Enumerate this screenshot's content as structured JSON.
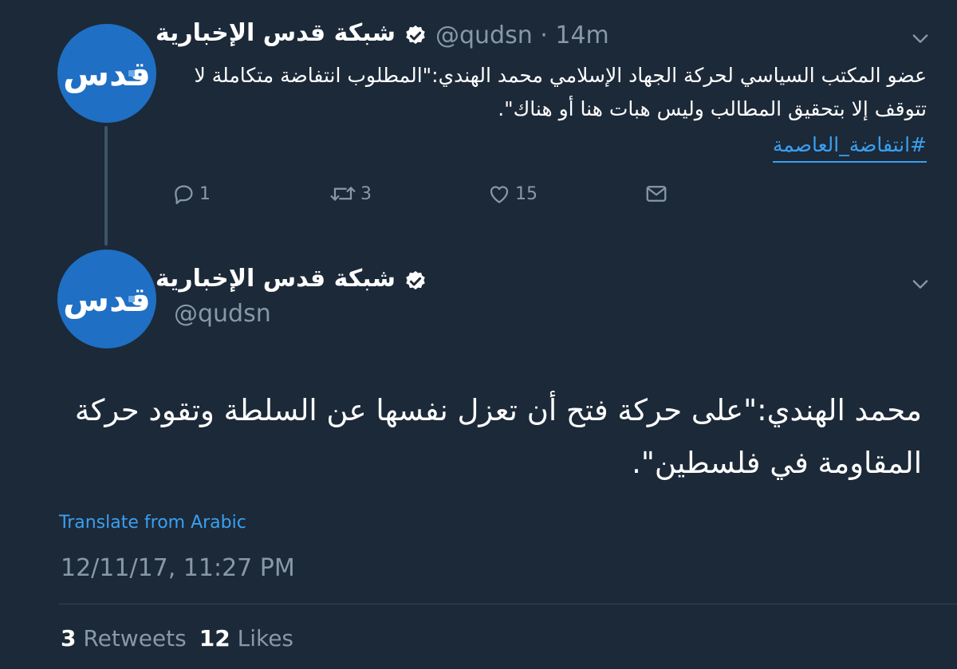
{
  "colors": {
    "background": "#1c2938",
    "text_primary": "#ffffff",
    "text_secondary": "#8899a6",
    "link": "#3aa0f0",
    "avatar_blue": "#1f6fc4",
    "thread_line": "#3d5466"
  },
  "account": {
    "display_name": "شبكة قدس الإخبارية",
    "handle": "@qudsn",
    "verified_icon": "verified-badge-icon",
    "avatar_logo_text": "قدس"
  },
  "tweet_parent": {
    "handle_time": "@qudsn · 14m",
    "text": "عضو المكتب السياسي لحركة الجهاد الإسلامي محمد الهندي:\"المطلوب انتفاضة متكاملة لا تتوقف إلا بتحقيق المطالب وليس هبات هنا أو هناك\".",
    "hashtag": "#انتفاضة_العاصمة",
    "actions": {
      "reply_count": "1",
      "retweet_count": "3",
      "like_count": "15",
      "reply_icon": "reply-icon",
      "retweet_icon": "retweet-icon",
      "like_icon": "heart-icon",
      "dm_icon": "envelope-icon"
    }
  },
  "tweet_main": {
    "handle": "@qudsn",
    "text": "محمد الهندي:\"على حركة فتح أن تعزل نفسها عن السلطة وتقود حركة المقاومة في فلسطين\".",
    "translate_link": "Translate from Arabic",
    "timestamp": "12/11/17, 11:27 PM",
    "retweets_count": "3",
    "retweets_label": "Retweets",
    "likes_count": "12",
    "likes_label": "Likes"
  }
}
